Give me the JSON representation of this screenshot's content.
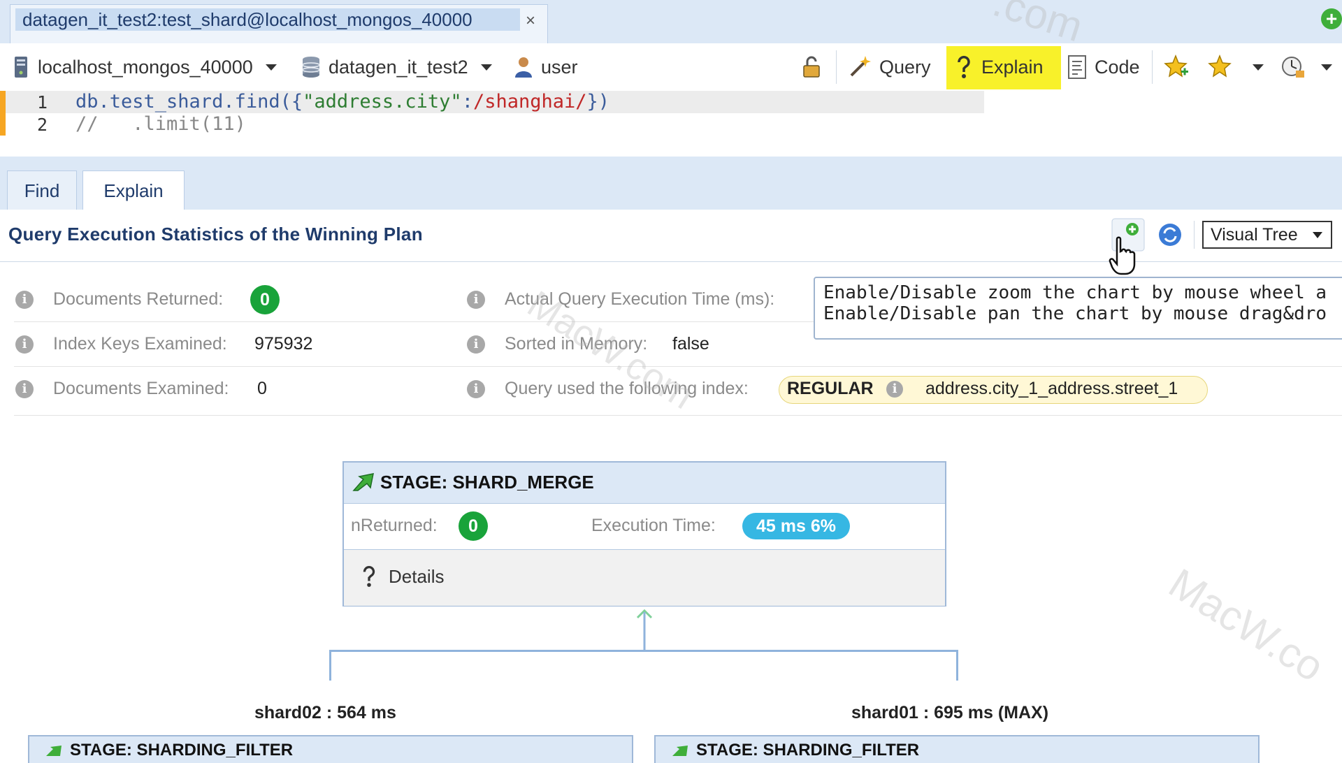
{
  "connection_tab": {
    "label": "datagen_it_test2:test_shard@localhost_mongos_40000",
    "close": "×"
  },
  "add_tab": "+",
  "toolbar": {
    "server": "localhost_mongos_40000",
    "database": "datagen_it_test2",
    "user": "user",
    "query_label": "Query",
    "explain_label": "Explain",
    "code_label": "Code"
  },
  "editor": {
    "lines": [
      {
        "num": "1",
        "parts": {
          "obj": "db.test_shard.find({",
          "key": "\"address.city\"",
          "colon": ":",
          "regex": "/shanghai/",
          "end": "})"
        }
      },
      {
        "num": "2",
        "comment": "//   .limit(11)"
      }
    ]
  },
  "result_tabs": [
    "Find",
    "Explain"
  ],
  "plan": {
    "title": "Query Execution Statistics of the Winning Plan",
    "view_mode": "Visual Tree",
    "tooltip_lines": [
      "Enable/Disable zoom the chart by mouse wheel a",
      "Enable/Disable pan the chart by mouse drag&dro"
    ]
  },
  "stats": {
    "docs_returned_label": "Documents Returned:",
    "docs_returned": "0",
    "keys_examined_label": "Index Keys Examined:",
    "keys_examined": "975932",
    "docs_examined_label": "Documents Examined:",
    "docs_examined": "0",
    "exec_time_label": "Actual Query Execution Time (ms):",
    "sorted_label": "Sorted in Memory:",
    "sorted": "false",
    "index_label": "Query used the following index:",
    "index_type": "REGULAR",
    "index_name": "address.city_1_address.street_1"
  },
  "stage": {
    "title": "STAGE: SHARD_MERGE",
    "nreturned_label": "nReturned:",
    "nreturned": "0",
    "exec_label": "Execution Time:",
    "exec_value": "45 ms  6%",
    "details": "Details"
  },
  "shards": [
    {
      "label": "shard02 : 564 ms",
      "stage": "STAGE: SHARDING_FILTER"
    },
    {
      "label": "shard01 : 695 ms (MAX)",
      "stage": "STAGE: SHARDING_FILTER"
    }
  ],
  "colors": {
    "explain_highlight": "#f8f12a",
    "badge_green": "#19a33a",
    "exec_pill": "#36b7e3",
    "arrow_red": "#d0141b"
  }
}
